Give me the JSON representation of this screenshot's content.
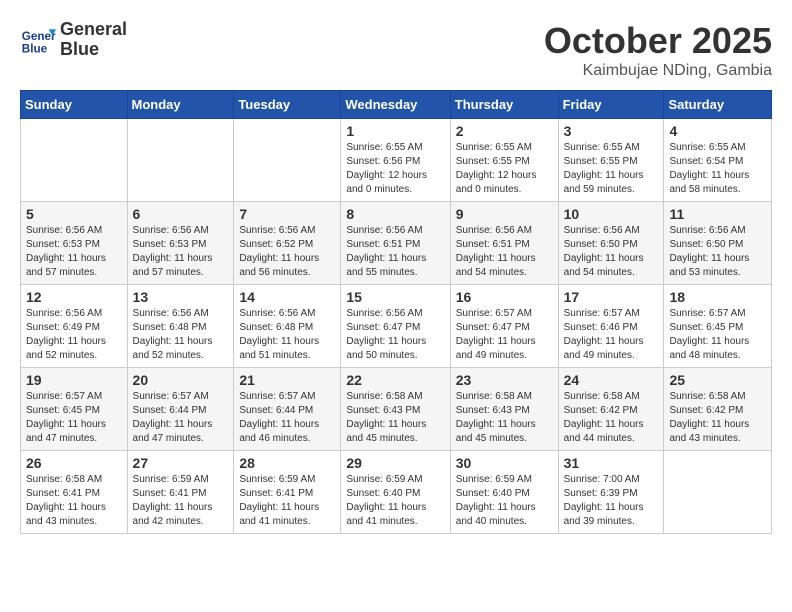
{
  "header": {
    "logo_line1": "General",
    "logo_line2": "Blue",
    "month": "October 2025",
    "location": "Kaimbujae NDing, Gambia"
  },
  "weekdays": [
    "Sunday",
    "Monday",
    "Tuesday",
    "Wednesday",
    "Thursday",
    "Friday",
    "Saturday"
  ],
  "weeks": [
    [
      {
        "day": "",
        "info": ""
      },
      {
        "day": "",
        "info": ""
      },
      {
        "day": "",
        "info": ""
      },
      {
        "day": "1",
        "info": "Sunrise: 6:55 AM\nSunset: 6:56 PM\nDaylight: 12 hours\nand 0 minutes."
      },
      {
        "day": "2",
        "info": "Sunrise: 6:55 AM\nSunset: 6:55 PM\nDaylight: 12 hours\nand 0 minutes."
      },
      {
        "day": "3",
        "info": "Sunrise: 6:55 AM\nSunset: 6:55 PM\nDaylight: 11 hours\nand 59 minutes."
      },
      {
        "day": "4",
        "info": "Sunrise: 6:55 AM\nSunset: 6:54 PM\nDaylight: 11 hours\nand 58 minutes."
      }
    ],
    [
      {
        "day": "5",
        "info": "Sunrise: 6:56 AM\nSunset: 6:53 PM\nDaylight: 11 hours\nand 57 minutes."
      },
      {
        "day": "6",
        "info": "Sunrise: 6:56 AM\nSunset: 6:53 PM\nDaylight: 11 hours\nand 57 minutes."
      },
      {
        "day": "7",
        "info": "Sunrise: 6:56 AM\nSunset: 6:52 PM\nDaylight: 11 hours\nand 56 minutes."
      },
      {
        "day": "8",
        "info": "Sunrise: 6:56 AM\nSunset: 6:51 PM\nDaylight: 11 hours\nand 55 minutes."
      },
      {
        "day": "9",
        "info": "Sunrise: 6:56 AM\nSunset: 6:51 PM\nDaylight: 11 hours\nand 54 minutes."
      },
      {
        "day": "10",
        "info": "Sunrise: 6:56 AM\nSunset: 6:50 PM\nDaylight: 11 hours\nand 54 minutes."
      },
      {
        "day": "11",
        "info": "Sunrise: 6:56 AM\nSunset: 6:50 PM\nDaylight: 11 hours\nand 53 minutes."
      }
    ],
    [
      {
        "day": "12",
        "info": "Sunrise: 6:56 AM\nSunset: 6:49 PM\nDaylight: 11 hours\nand 52 minutes."
      },
      {
        "day": "13",
        "info": "Sunrise: 6:56 AM\nSunset: 6:48 PM\nDaylight: 11 hours\nand 52 minutes."
      },
      {
        "day": "14",
        "info": "Sunrise: 6:56 AM\nSunset: 6:48 PM\nDaylight: 11 hours\nand 51 minutes."
      },
      {
        "day": "15",
        "info": "Sunrise: 6:56 AM\nSunset: 6:47 PM\nDaylight: 11 hours\nand 50 minutes."
      },
      {
        "day": "16",
        "info": "Sunrise: 6:57 AM\nSunset: 6:47 PM\nDaylight: 11 hours\nand 49 minutes."
      },
      {
        "day": "17",
        "info": "Sunrise: 6:57 AM\nSunset: 6:46 PM\nDaylight: 11 hours\nand 49 minutes."
      },
      {
        "day": "18",
        "info": "Sunrise: 6:57 AM\nSunset: 6:45 PM\nDaylight: 11 hours\nand 48 minutes."
      }
    ],
    [
      {
        "day": "19",
        "info": "Sunrise: 6:57 AM\nSunset: 6:45 PM\nDaylight: 11 hours\nand 47 minutes."
      },
      {
        "day": "20",
        "info": "Sunrise: 6:57 AM\nSunset: 6:44 PM\nDaylight: 11 hours\nand 47 minutes."
      },
      {
        "day": "21",
        "info": "Sunrise: 6:57 AM\nSunset: 6:44 PM\nDaylight: 11 hours\nand 46 minutes."
      },
      {
        "day": "22",
        "info": "Sunrise: 6:58 AM\nSunset: 6:43 PM\nDaylight: 11 hours\nand 45 minutes."
      },
      {
        "day": "23",
        "info": "Sunrise: 6:58 AM\nSunset: 6:43 PM\nDaylight: 11 hours\nand 45 minutes."
      },
      {
        "day": "24",
        "info": "Sunrise: 6:58 AM\nSunset: 6:42 PM\nDaylight: 11 hours\nand 44 minutes."
      },
      {
        "day": "25",
        "info": "Sunrise: 6:58 AM\nSunset: 6:42 PM\nDaylight: 11 hours\nand 43 minutes."
      }
    ],
    [
      {
        "day": "26",
        "info": "Sunrise: 6:58 AM\nSunset: 6:41 PM\nDaylight: 11 hours\nand 43 minutes."
      },
      {
        "day": "27",
        "info": "Sunrise: 6:59 AM\nSunset: 6:41 PM\nDaylight: 11 hours\nand 42 minutes."
      },
      {
        "day": "28",
        "info": "Sunrise: 6:59 AM\nSunset: 6:41 PM\nDaylight: 11 hours\nand 41 minutes."
      },
      {
        "day": "29",
        "info": "Sunrise: 6:59 AM\nSunset: 6:40 PM\nDaylight: 11 hours\nand 41 minutes."
      },
      {
        "day": "30",
        "info": "Sunrise: 6:59 AM\nSunset: 6:40 PM\nDaylight: 11 hours\nand 40 minutes."
      },
      {
        "day": "31",
        "info": "Sunrise: 7:00 AM\nSunset: 6:39 PM\nDaylight: 11 hours\nand 39 minutes."
      },
      {
        "day": "",
        "info": ""
      }
    ]
  ]
}
